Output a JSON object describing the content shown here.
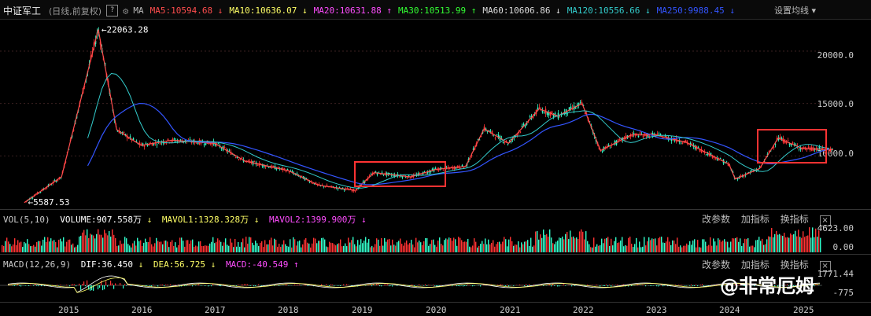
{
  "header": {
    "title": "中证军工",
    "subtitle": "(日线,前复权)",
    "help_icon": "?",
    "ma_label": "MA",
    "settings_label": "设置均线",
    "ma_items": [
      {
        "text": "MA5:10594.68",
        "arrow": "↓",
        "color": "#ff4d4d"
      },
      {
        "text": "MA10:10636.07",
        "arrow": "↓",
        "color": "#ffff66"
      },
      {
        "text": "MA20:10631.88",
        "arrow": "↑",
        "color": "#ff4dff"
      },
      {
        "text": "MA30:10513.99",
        "arrow": "↑",
        "color": "#33ff33"
      },
      {
        "text": "MA60:10606.86",
        "arrow": "↓",
        "color": "#dddddd"
      },
      {
        "text": "MA120:10556.66",
        "arrow": "↓",
        "color": "#33cccc"
      },
      {
        "text": "MA250:9988.45",
        "arrow": "↓",
        "color": "#3355ff"
      }
    ]
  },
  "price_axis": [
    "20000.0",
    "15000.0",
    "10000.0"
  ],
  "annotations": {
    "high": "22063.28",
    "low": "5587.53"
  },
  "volume_panel": {
    "label": "VOL(5,10)",
    "volume": "VOLUME:907.558万",
    "mavol1": "MAVOL1:1328.328万",
    "mavol2": "MAVOL2:1399.900万",
    "axis_top": "4623.00",
    "axis_bottom": "0.00",
    "btn_params": "改参数",
    "btn_add": "加指标",
    "btn_switch": "换指标",
    "close": "×"
  },
  "macd_panel": {
    "label": "MACD(12,26,9)",
    "dif": "DIF:36.450",
    "dea": "DEA:56.725",
    "macd": "MACD:-40.549",
    "axis_top": "1771.44",
    "axis_bottom": "-775",
    "btn_params": "改参数",
    "btn_add": "加指标",
    "btn_switch": "换指标",
    "close": "×"
  },
  "x_axis": [
    "2015",
    "2016",
    "2017",
    "2018",
    "2019",
    "2020",
    "2021",
    "2022",
    "2023",
    "2024",
    "2025"
  ],
  "watermark": "@非常厄姆",
  "chart_data": {
    "type": "line",
    "title": "中证军工",
    "x": [
      "2014-06",
      "2014-12",
      "2015-06",
      "2015-09",
      "2016-01",
      "2016-06",
      "2017-01",
      "2017-06",
      "2018-01",
      "2018-06",
      "2018-12",
      "2019-03",
      "2019-09",
      "2020-01",
      "2020-06",
      "2020-09",
      "2021-01",
      "2021-06",
      "2021-09",
      "2022-01",
      "2022-04",
      "2022-09",
      "2023-01",
      "2023-06",
      "2024-01",
      "2024-02",
      "2024-06",
      "2024-09",
      "2025-01",
      "2025-06"
    ],
    "series": [
      {
        "values": [
          5587.53,
          8000,
          22063.28,
          12500,
          11000,
          11500,
          11200,
          9500,
          8600,
          7200,
          6700,
          8400,
          8000,
          8700,
          9000,
          12600,
          11200,
          14500,
          13800,
          15000,
          10500,
          12000,
          12000,
          11300,
          9200,
          7800,
          8800,
          11700,
          10700,
          10594.68
        ]
      }
    ],
    "ylim": [
      5000,
      23000
    ]
  }
}
